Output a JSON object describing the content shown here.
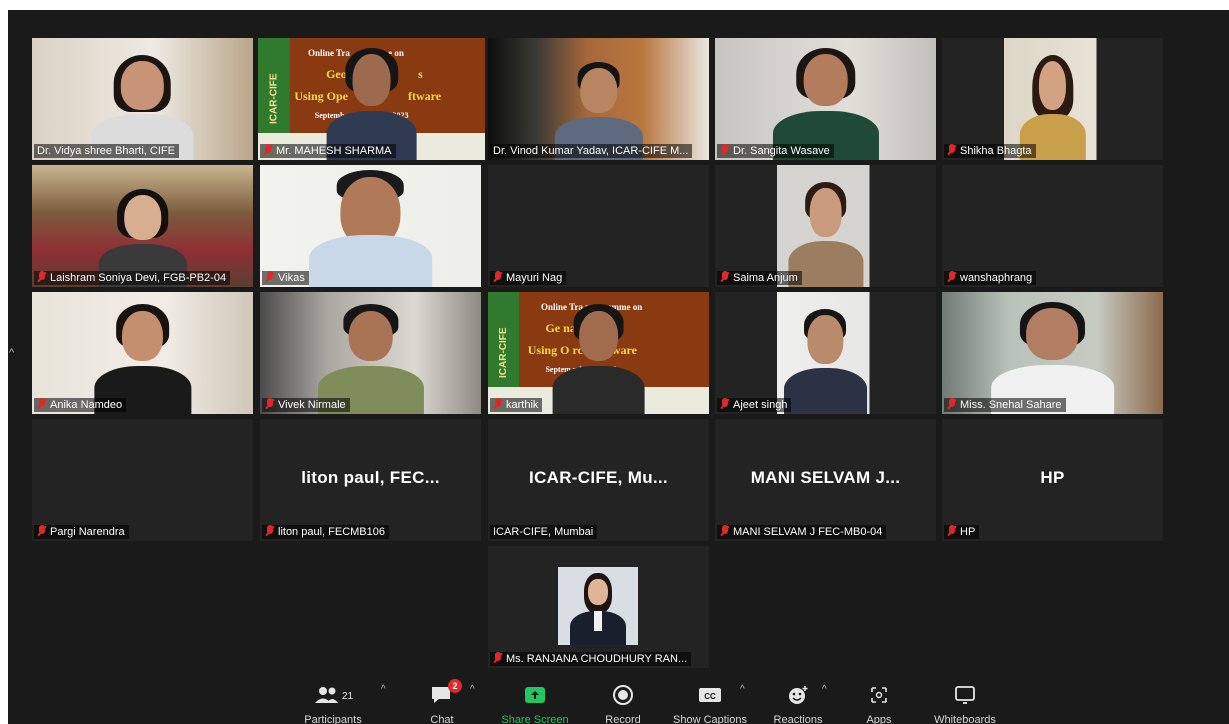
{
  "participants": [
    {
      "id": "p1",
      "name": "Dr. Vidya shree Bharti, CIFE",
      "muted": false
    },
    {
      "id": "p2",
      "name": "Mr. MAHESH SHARMA",
      "muted": true,
      "active": true
    },
    {
      "id": "p3",
      "name": "Dr. Vinod Kumar Yadav, ICAR-CIFE M...",
      "muted": false
    },
    {
      "id": "p4",
      "name": "Dr. Sangita Wasave",
      "muted": true
    },
    {
      "id": "p5",
      "name": "Shikha Bhagta",
      "muted": true
    },
    {
      "id": "p6",
      "name": "Laishram Soniya Devi, FGB-PB2-04",
      "muted": true
    },
    {
      "id": "p7",
      "name": "Vikas",
      "muted": true
    },
    {
      "id": "p8",
      "name": "Mayuri Nag",
      "muted": true
    },
    {
      "id": "p9",
      "name": "Saima Anjum",
      "muted": true
    },
    {
      "id": "p10",
      "name": "wanshaphrang",
      "muted": true
    },
    {
      "id": "p11",
      "name": "Anika Namdeo",
      "muted": true
    },
    {
      "id": "p12",
      "name": "Vivek Nirmale",
      "muted": true
    },
    {
      "id": "p13",
      "name": "karthik",
      "muted": true
    },
    {
      "id": "p14",
      "name": "Ajeet singh",
      "muted": true
    },
    {
      "id": "p15",
      "name": "Miss. Snehal Sahare",
      "muted": true
    },
    {
      "id": "p16",
      "name": "Pargi Narendra",
      "muted": true
    },
    {
      "id": "p17",
      "name": "liton paul, FECMB106",
      "display": "liton paul, FEC...",
      "muted": true
    },
    {
      "id": "p18",
      "name": "ICAR-CIFE, Mumbai",
      "display": "ICAR-CIFE, Mu...",
      "muted": false
    },
    {
      "id": "p19",
      "name": "MANI SELVAM J FEC-MB0-04",
      "display": "MANI SELVAM J...",
      "muted": true
    },
    {
      "id": "p20",
      "name": "HP",
      "display": "HP",
      "muted": true
    },
    {
      "id": "p21",
      "name": "Ms. RANJANA CHOUDHURY RAN...",
      "muted": true
    }
  ],
  "banner": {
    "side_text": "ICAR-CIFE",
    "line1_a": "Online Tra",
    "line1_b": "e on",
    "line2_a": "Geosp",
    "line2_b": "s",
    "line3_a": "Using Ope",
    "line3_b": "ftware",
    "line4_a": "Septemb",
    "line4_b": ", 2023",
    "k_line1": "Online Tra      programme on",
    "k_line2": "Ge           nalysis",
    "k_line3": "Using O        rce Software",
    "k_line4": "Septem         mber 9, 2023"
  },
  "toolbar": {
    "participants_label": "Participants",
    "participants_count": "21",
    "chat_label": "Chat",
    "chat_badge": "2",
    "share_label": "Share Screen",
    "record_label": "Record",
    "captions_label": "Show Captions",
    "captions_icon_text": "CC",
    "reactions_label": "Reactions",
    "apps_label": "Apps",
    "whiteboards_label": "Whiteboards"
  },
  "icons": {
    "muted_mic": "mic-muted-icon",
    "participants": "participants-icon",
    "chat": "chat-icon",
    "share": "share-screen-icon",
    "record": "record-icon",
    "captions": "captions-icon",
    "reactions": "reactions-icon",
    "apps": "apps-icon",
    "whiteboards": "whiteboard-icon",
    "caret": "caret-up-icon"
  },
  "colors": {
    "background": "#1a1a1a",
    "tile": "#232323",
    "active_border": "#d6e45a",
    "muted": "#e02828",
    "share_green": "#22c55e"
  }
}
